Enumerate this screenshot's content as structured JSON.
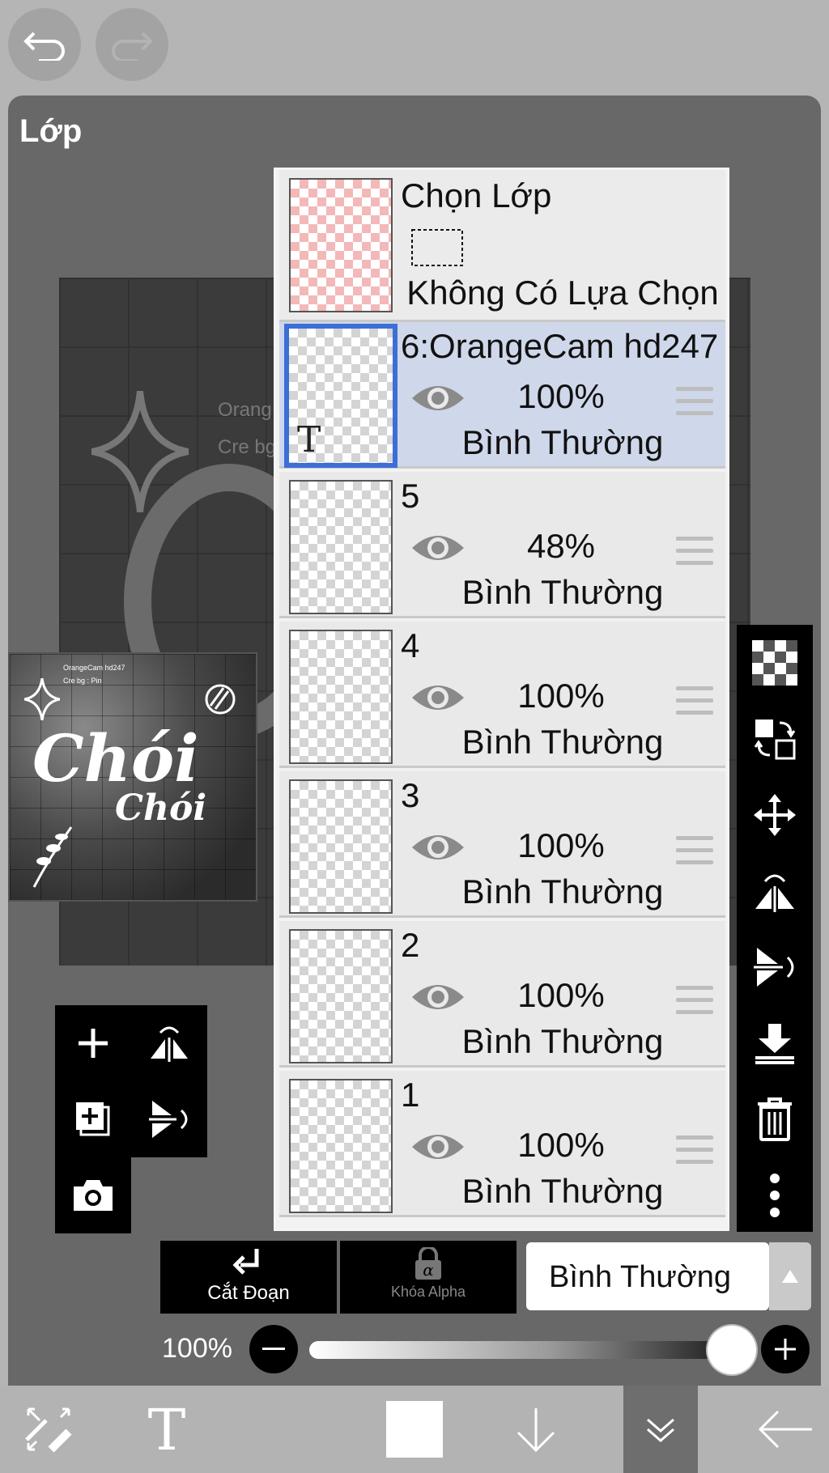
{
  "panel": {
    "title": "Lớp"
  },
  "canvas_text": {
    "line1": "Orang",
    "line2": "Cre bg"
  },
  "thumbnail": {
    "credit1": "OrangeCam hd247",
    "credit2": "Cre bg : Pin",
    "word1": "Chói",
    "word2": "Chói"
  },
  "selection_row": {
    "title": "Chọn Lớp",
    "status": "Không Có Lựa Chọn"
  },
  "layers": [
    {
      "name": "6:OrangeCam hd247",
      "opacity": "100%",
      "blend": "Bình Thường",
      "selected": true
    },
    {
      "name": "5",
      "opacity": "48%",
      "blend": "Bình Thường",
      "selected": false
    },
    {
      "name": "4",
      "opacity": "100%",
      "blend": "Bình Thường",
      "selected": false
    },
    {
      "name": "3",
      "opacity": "100%",
      "blend": "Bình Thường",
      "selected": false
    },
    {
      "name": "2",
      "opacity": "100%",
      "blend": "Bình Thường",
      "selected": false
    },
    {
      "name": "1",
      "opacity": "100%",
      "blend": "Bình Thường",
      "selected": false
    }
  ],
  "controls": {
    "clip_label": "Cắt Đoạn",
    "alpha_lock_label": "Khóa Alpha",
    "blend_mode": "Bình Thường",
    "opacity_label": "100%",
    "opacity_value": 1.0
  },
  "colors": {
    "accent": "#3b6fd6",
    "panel": "#686868",
    "selected_row": "#cfd7ea"
  }
}
